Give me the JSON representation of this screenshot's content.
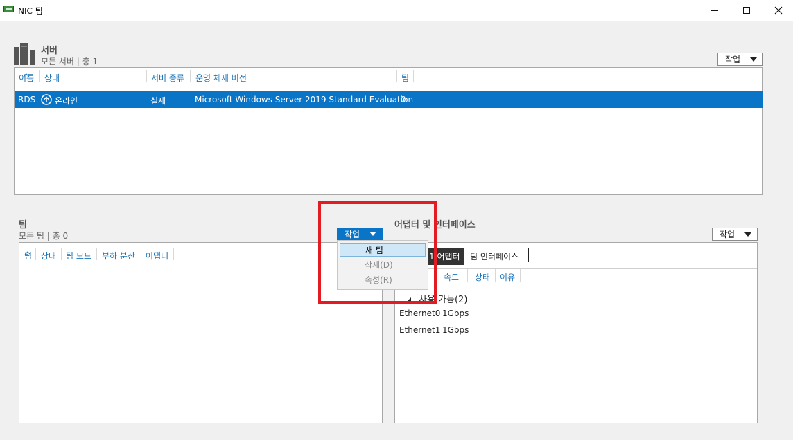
{
  "window": {
    "title": "NIC 팀"
  },
  "servers": {
    "title": "서버",
    "subtitle": "모든 서버 | 총 1",
    "task_label": "작업",
    "columns": [
      "이름",
      "상태",
      "서버 종류",
      "운영 체제 버전",
      "팀"
    ],
    "rows": [
      {
        "name": "RDS",
        "status": "온라인",
        "type": "실제",
        "os": "Microsoft Windows Server 2019 Standard Evaluation",
        "teams": "0"
      }
    ]
  },
  "teams": {
    "title": "팀",
    "subtitle": "모든 팀 | 총 0",
    "task_label": "작업",
    "columns": [
      "팀",
      "상태",
      "팀 모드",
      "부하 분산",
      "어댑터"
    ],
    "menu": {
      "new_team": "새 팀",
      "delete": "삭제(D)",
      "properties": "속성(R)"
    }
  },
  "adapters": {
    "title": "어댑터 및 인터페이스",
    "task_label": "작업",
    "tabs": [
      "네트워크 어댑터",
      "팀 인터페이스"
    ],
    "tab_visible_fragment": "1 어댑터",
    "columns": [
      "속도",
      "상태",
      "이유"
    ],
    "group_label": "사용 가능(2)",
    "items": [
      {
        "name": "Ethernet0",
        "speed": "1Gbps"
      },
      {
        "name": "Ethernet1",
        "speed": "1Gbps"
      }
    ]
  }
}
